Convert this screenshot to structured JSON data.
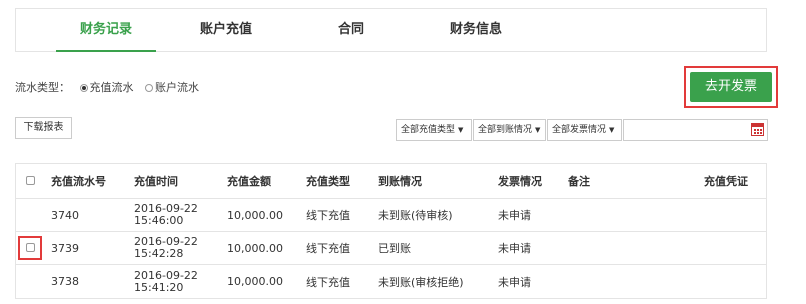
{
  "tabs": [
    "财务记录",
    "账户充值",
    "合同",
    "财务信息"
  ],
  "flow": {
    "label": "流水类型：",
    "options": [
      "充值流水",
      "账户流水"
    ],
    "selected": "充值流水"
  },
  "invoice_button": "去开发票",
  "download_button": "下载报表",
  "filters": {
    "recharge_type": "全部充值类型",
    "arrival_status": "全部到账情况",
    "invoice_status": "全部发票情况",
    "date_value": ""
  },
  "table": {
    "headers": [
      "充值流水号",
      "充值时间",
      "充值金额",
      "充值类型",
      "到账情况",
      "发票情况",
      "备注",
      "充值凭证"
    ],
    "rows": [
      {
        "id": "3740",
        "date": "2016-09-22",
        "time": "15:46:00",
        "amount": "10,000.00",
        "type": "线下充值",
        "arrival": "未到账(待审核)",
        "invoice": "未申请",
        "note": "",
        "voucher": ""
      },
      {
        "id": "3739",
        "date": "2016-09-22",
        "time": "15:42:28",
        "amount": "10,000.00",
        "type": "线下充值",
        "arrival": "已到账",
        "invoice": "未申请",
        "note": "",
        "voucher": ""
      },
      {
        "id": "3738",
        "date": "2016-09-22",
        "time": "15:41:20",
        "amount": "10,000.00",
        "type": "线下充值",
        "arrival": "未到账(审核拒绝)",
        "invoice": "未申请",
        "note": "",
        "voucher": ""
      }
    ]
  },
  "colors": {
    "accent": "#3aa14c",
    "highlight": "#e23a3a"
  }
}
